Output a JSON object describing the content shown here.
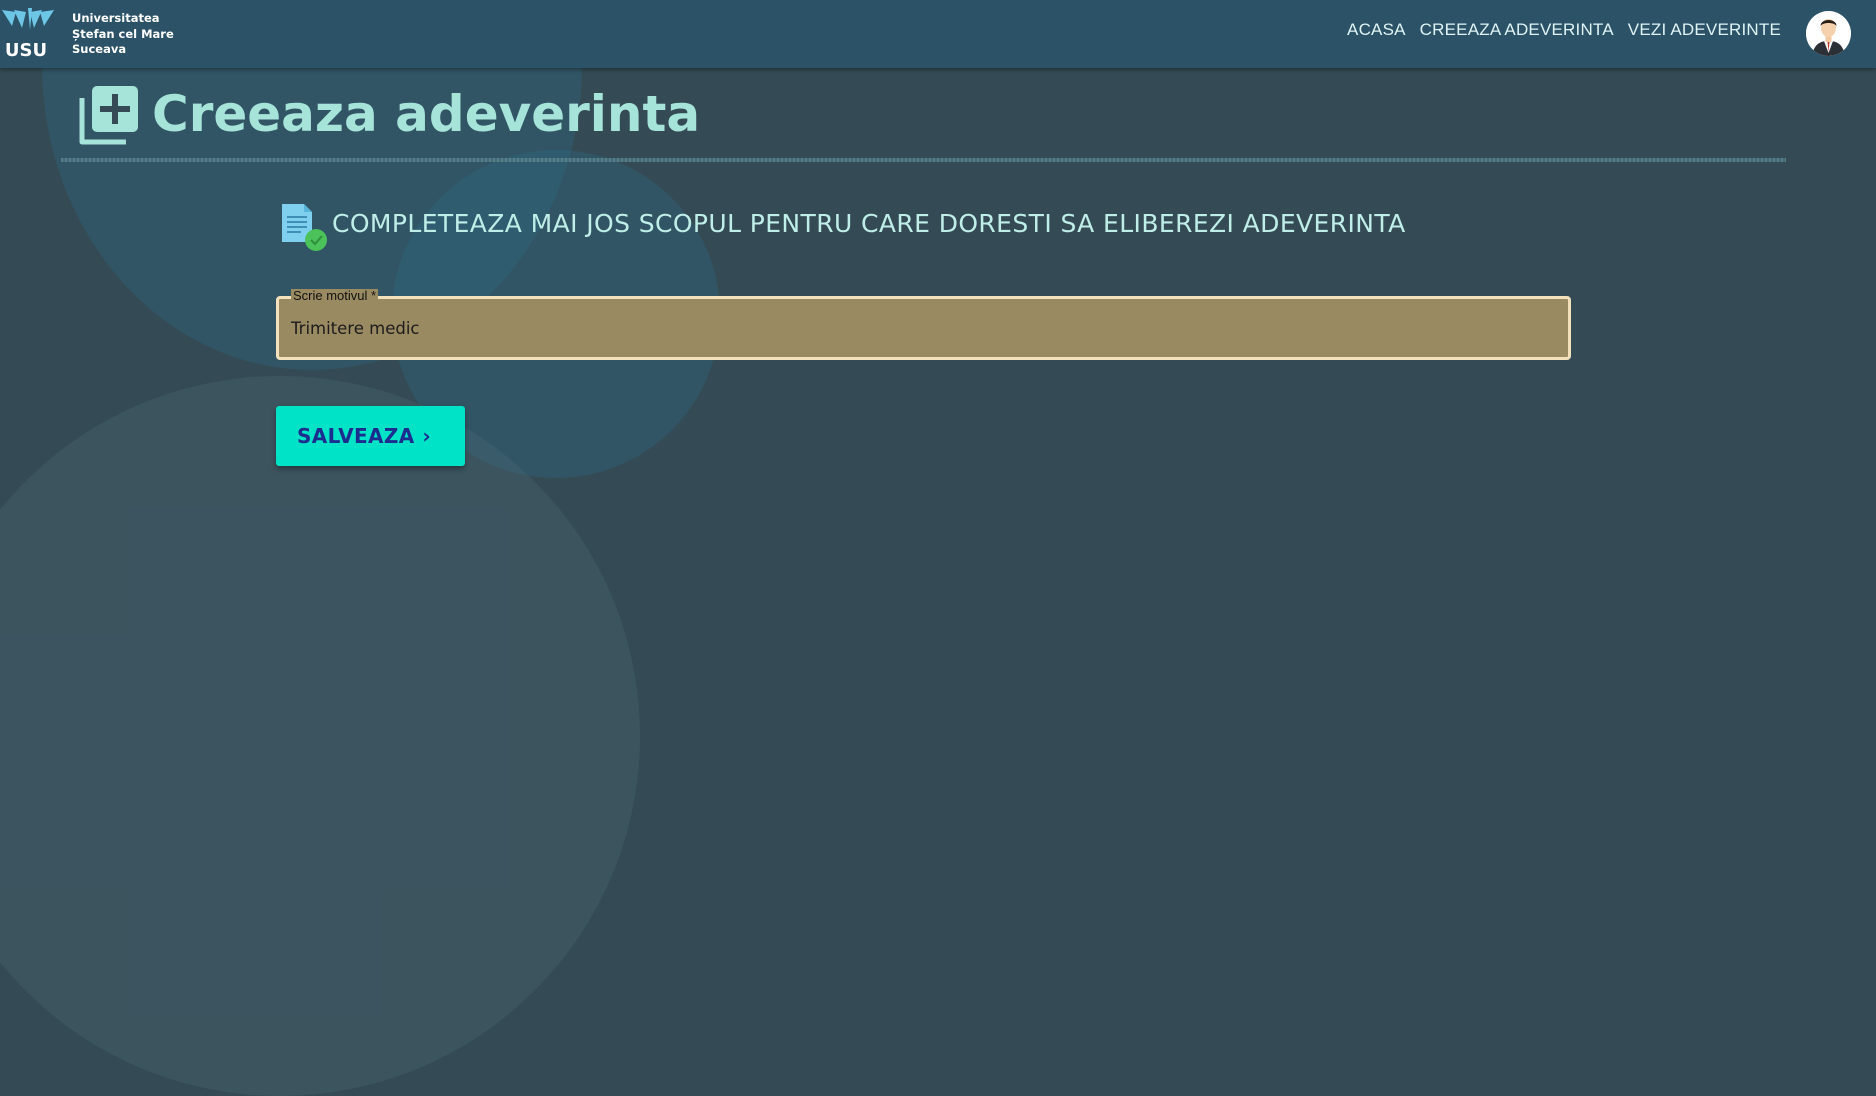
{
  "brand": {
    "logo_text": "USU",
    "name_lines": [
      "Universitatea",
      "Ștefan cel Mare",
      "Suceava"
    ]
  },
  "nav": {
    "items": [
      {
        "label": "ACASA"
      },
      {
        "label": "CREEAZA ADEVERINTA"
      },
      {
        "label": "VEZI ADEVERINTE"
      }
    ]
  },
  "page": {
    "title": "Creeaza adeverinta",
    "subtitle": "COMPLETEAZA MAI JOS SCOPUL PENTRU CARE DORESTI SA ELIBEREZI ADEVERINTA"
  },
  "form": {
    "reason_label": "Scrie motivul *",
    "reason_value": "Trimitere medic",
    "save_label": "SALVEAZA",
    "save_icon": "chevron-right-icon"
  },
  "colors": {
    "background": "#344b55",
    "header": "#2b5266",
    "accent": "#00e3c6",
    "button_text": "#1b2d8f",
    "title": "#a6e4da",
    "input_fill": "#9a8a62",
    "input_border": "#f3e0bd"
  }
}
